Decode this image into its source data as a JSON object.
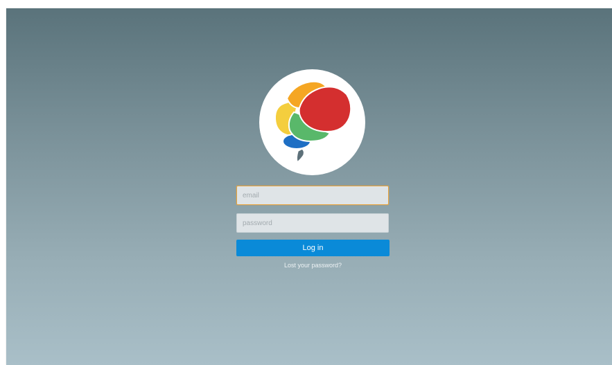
{
  "logo": {
    "icon": "brain-logo-icon",
    "colors": {
      "orange": "#f5a623",
      "red": "#d42f2f",
      "yellow": "#f4ce3e",
      "green": "#59b86a",
      "blue": "#1e6fc4",
      "stem": "#5d7079"
    }
  },
  "form": {
    "email_placeholder": "email",
    "email_value": "",
    "password_placeholder": "password",
    "password_value": "",
    "login_label": "Log in",
    "lost_password_label": "Lost your password?"
  },
  "colors": {
    "accent": "#0a8ad8",
    "focus_border": "#e8a33b"
  }
}
